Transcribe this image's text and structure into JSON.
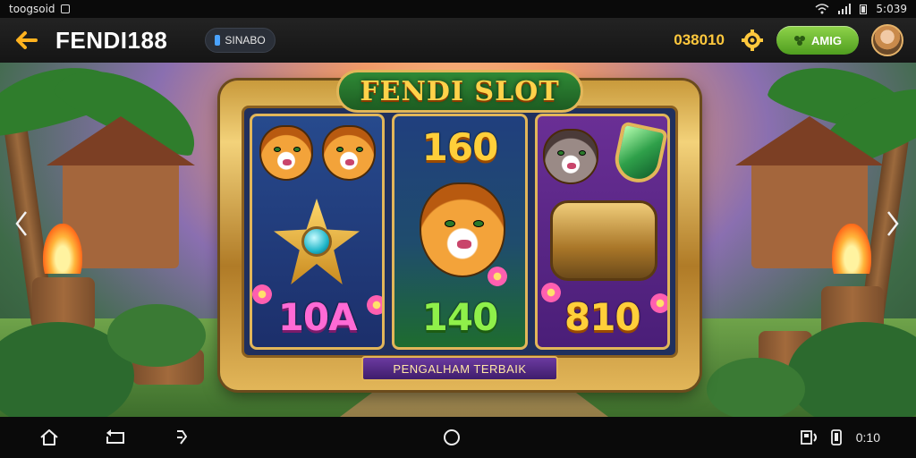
{
  "status_bar": {
    "left_text": "toogsoid",
    "right_text": "5:039",
    "icons": [
      "square-icon",
      "wifi-icon",
      "signal-icon",
      "battery-icon"
    ]
  },
  "header": {
    "title": "FENDI188",
    "chip_label": "SINABO",
    "balance": "038010",
    "action_button": "AMIG",
    "accent_green": "#6bbf2a",
    "accent_gold": "#ffc83d"
  },
  "game": {
    "logo": "FENDI SLOT",
    "bottom_banner": "PENGALHAM TERBAIK",
    "reels": [
      {
        "top_symbols": [
          "tiger-icon",
          "tiger-icon"
        ],
        "middle_symbol": "star-gem-icon",
        "value": "10A",
        "color": "#ff6ad5"
      },
      {
        "top_value": "160",
        "middle_symbol": "tiger-icon",
        "value": "140",
        "color": "#8ff04a"
      },
      {
        "top_symbols": [
          "panther-icon",
          "emerald-shield-icon"
        ],
        "middle_symbol": "golden-barrel-icon",
        "value": "810",
        "color": "#ffcf3a"
      }
    ]
  },
  "navbar": {
    "icons": [
      "home-icon",
      "back-icon",
      "recent-icon",
      "circle-home-icon"
    ],
    "right_text": "0:10"
  }
}
